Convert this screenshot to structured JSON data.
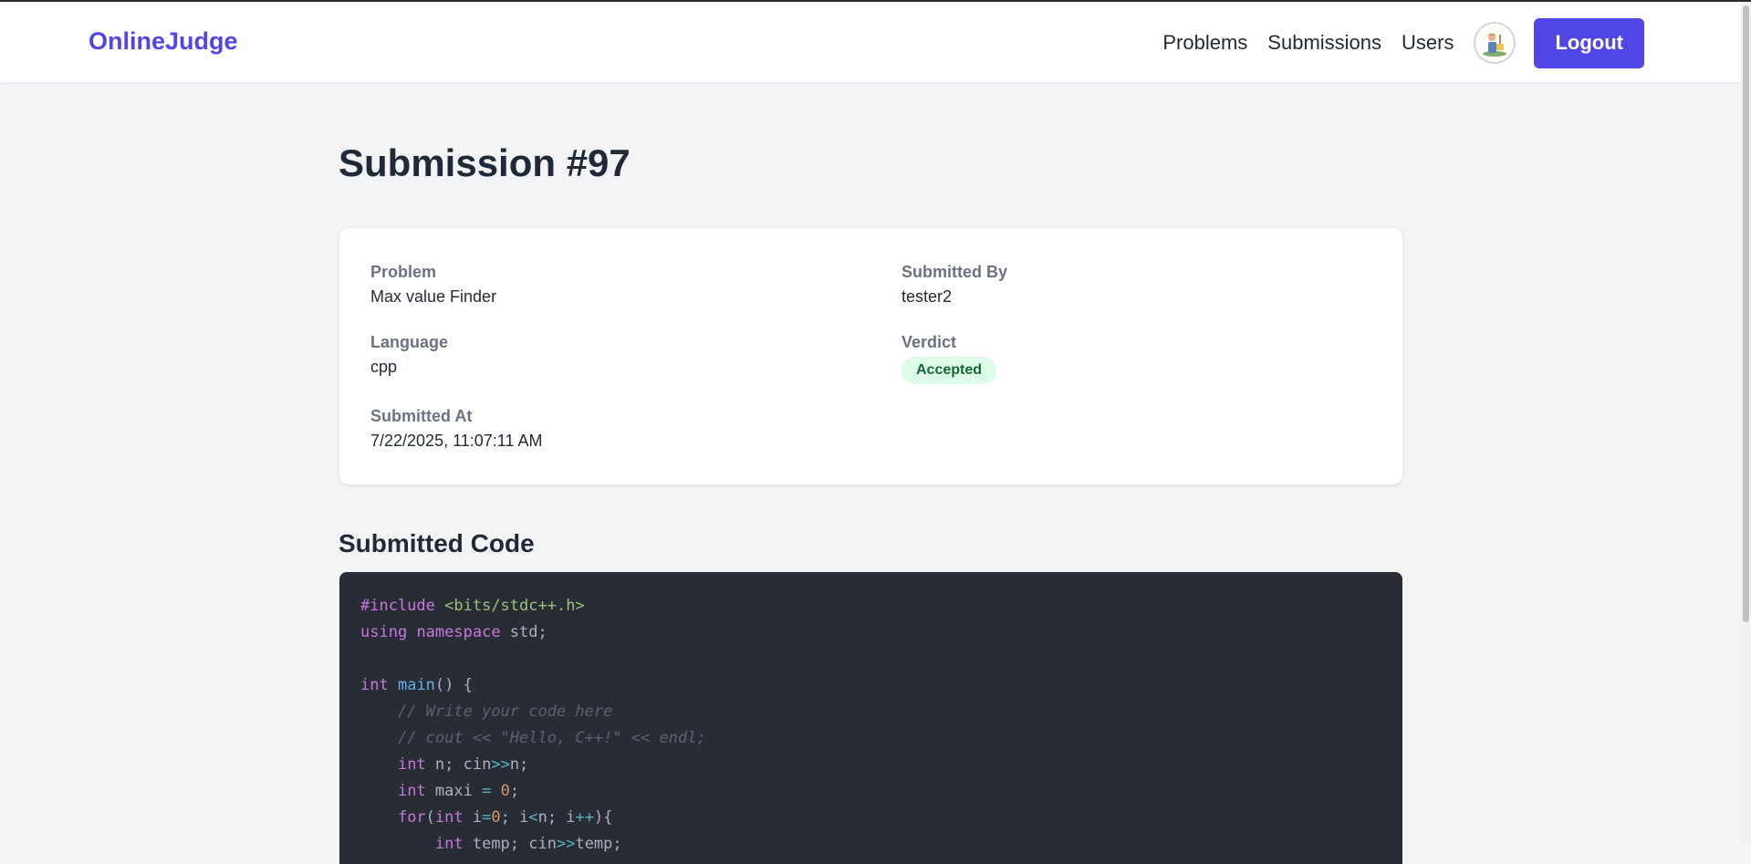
{
  "navbar": {
    "brand": "OnlineJudge",
    "links": [
      "Problems",
      "Submissions",
      "Users"
    ],
    "logout_label": "Logout"
  },
  "page": {
    "title": "Submission #97"
  },
  "details": {
    "problem": {
      "label": "Problem",
      "value": "Max value Finder"
    },
    "submitted_by": {
      "label": "Submitted By",
      "value": "tester2"
    },
    "language": {
      "label": "Language",
      "value": "cpp"
    },
    "verdict": {
      "label": "Verdict",
      "value": "Accepted"
    },
    "submitted_at": {
      "label": "Submitted At",
      "value": "7/22/2025, 11:07:11 AM"
    }
  },
  "code_section": {
    "title": "Submitted Code",
    "lines": [
      [
        {
          "t": "#include",
          "c": "keyword"
        },
        {
          "t": " "
        },
        {
          "t": "<bits/stdc++.h>",
          "c": "string"
        }
      ],
      [
        {
          "t": "using",
          "c": "keyword"
        },
        {
          "t": " "
        },
        {
          "t": "namespace",
          "c": "keyword"
        },
        {
          "t": " std;"
        }
      ],
      [],
      [
        {
          "t": "int",
          "c": "keyword"
        },
        {
          "t": " "
        },
        {
          "t": "main",
          "c": "func"
        },
        {
          "t": "() {"
        }
      ],
      [
        {
          "t": "    "
        },
        {
          "t": "// Write your code here",
          "c": "comment"
        }
      ],
      [
        {
          "t": "    "
        },
        {
          "t": "// cout << \"Hello, C++!\" << endl;",
          "c": "comment"
        }
      ],
      [
        {
          "t": "    "
        },
        {
          "t": "int",
          "c": "keyword"
        },
        {
          "t": " n; cin"
        },
        {
          "t": ">>",
          "c": "op"
        },
        {
          "t": "n;"
        }
      ],
      [
        {
          "t": "    "
        },
        {
          "t": "int",
          "c": "keyword"
        },
        {
          "t": " maxi "
        },
        {
          "t": "=",
          "c": "op"
        },
        {
          "t": " "
        },
        {
          "t": "0",
          "c": "number"
        },
        {
          "t": ";"
        }
      ],
      [
        {
          "t": "    "
        },
        {
          "t": "for",
          "c": "keyword"
        },
        {
          "t": "("
        },
        {
          "t": "int",
          "c": "keyword"
        },
        {
          "t": " i"
        },
        {
          "t": "=",
          "c": "op"
        },
        {
          "t": "0",
          "c": "number"
        },
        {
          "t": "; i"
        },
        {
          "t": "<",
          "c": "op"
        },
        {
          "t": "n; i"
        },
        {
          "t": "++",
          "c": "op"
        },
        {
          "t": "){"
        }
      ],
      [
        {
          "t": "        "
        },
        {
          "t": "int",
          "c": "keyword"
        },
        {
          "t": " temp; cin"
        },
        {
          "t": ">>",
          "c": "op"
        },
        {
          "t": "temp;"
        }
      ]
    ]
  },
  "icons": {
    "avatar": "user-avatar-icon"
  },
  "colors": {
    "brand": "#4f46e5",
    "verdict_accepted_bg": "#dcfce7",
    "verdict_accepted_text": "#166534",
    "code_bg": "#282c34"
  }
}
